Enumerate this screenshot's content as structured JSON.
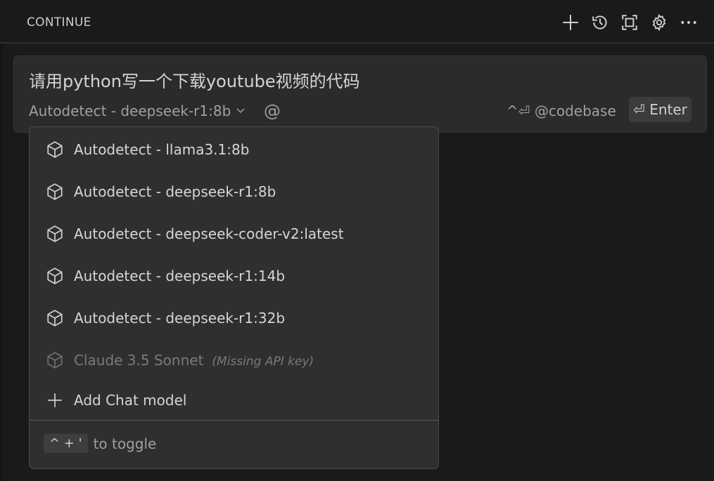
{
  "header": {
    "title": "CONTINUE",
    "actions": [
      "plus-icon",
      "history-icon",
      "fullscreen-icon",
      "gear-icon",
      "more-icon"
    ]
  },
  "input": {
    "prompt": "请用python写一个下载youtube视频的代码",
    "model_label": "Autodetect - deepseek-r1:8b",
    "at_symbol": "@",
    "codebase_hint": "^⏎ @codebase",
    "enter_label": "⏎ Enter"
  },
  "dropdown": {
    "items": [
      {
        "label": "Autodetect - llama3.1:8b",
        "icon": "cube-icon"
      },
      {
        "label": "Autodetect - deepseek-r1:8b",
        "icon": "cube-icon"
      },
      {
        "label": "Autodetect - deepseek-coder-v2:latest",
        "icon": "cube-icon"
      },
      {
        "label": "Autodetect - deepseek-r1:14b",
        "icon": "cube-icon"
      },
      {
        "label": "Autodetect - deepseek-r1:32b",
        "icon": "cube-icon"
      },
      {
        "label": "Claude 3.5 Sonnet",
        "note": "(Missing API key)",
        "icon": "cube-icon",
        "disabled": true
      }
    ],
    "add_label": "Add Chat model",
    "footer_keys": "^ + '",
    "footer_text": "to toggle"
  },
  "colors": {
    "background": "#1a1a1a",
    "panel": "#2b2b2b",
    "dropdown": "#2f2f2f",
    "text": "#d6d6d6",
    "muted": "#a0a0a0"
  }
}
